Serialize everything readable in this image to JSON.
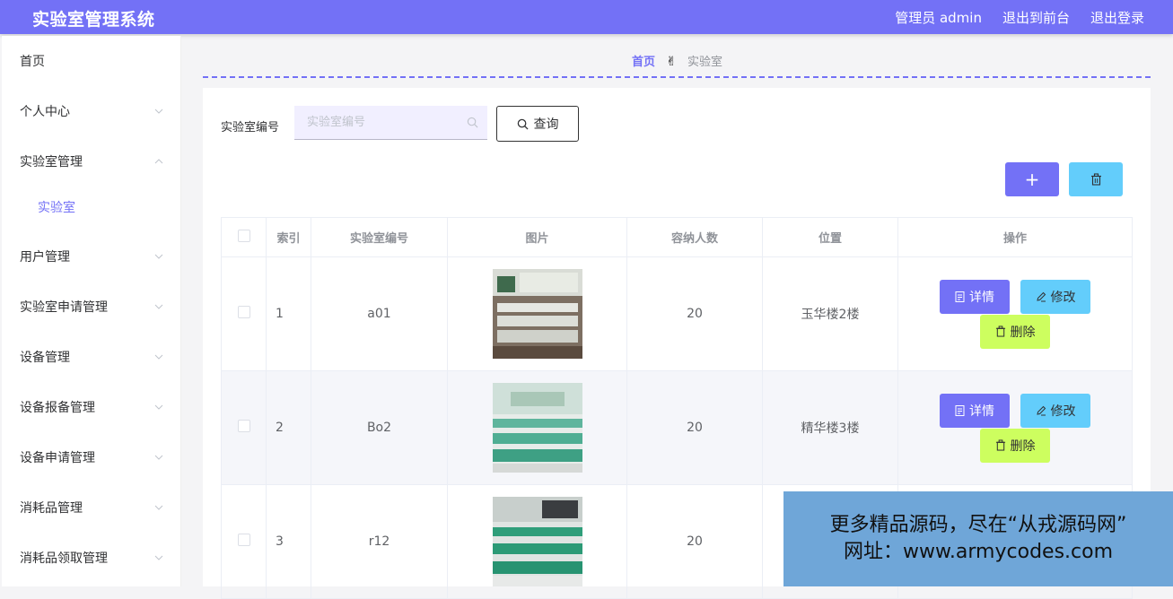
{
  "header": {
    "title": "实验室管理系统",
    "admin_label": "管理员 admin",
    "front_link": "退出到前台",
    "logout_link": "退出登录"
  },
  "sidebar": {
    "items": [
      {
        "label": "首页",
        "icon": "none"
      },
      {
        "label": "个人中心",
        "icon": "chevron-down-icon"
      },
      {
        "label": "实验室管理",
        "icon": "chevron-up-icon"
      },
      {
        "label": "实验室",
        "icon": "none"
      },
      {
        "label": "用户管理",
        "icon": "chevron-down-icon"
      },
      {
        "label": "实验室申请管理",
        "icon": "chevron-down-icon"
      },
      {
        "label": "设备管理",
        "icon": "chevron-down-icon"
      },
      {
        "label": "设备报备管理",
        "icon": "chevron-down-icon"
      },
      {
        "label": "设备申请管理",
        "icon": "chevron-down-icon"
      },
      {
        "label": "消耗品管理",
        "icon": "chevron-down-icon"
      },
      {
        "label": "消耗品领取管理",
        "icon": "chevron-down-icon"
      }
    ]
  },
  "breadcrumb": {
    "home": "首页",
    "separator": "✌",
    "current": "实验室"
  },
  "search": {
    "label": "实验室编号",
    "placeholder": "实验室编号",
    "value": "",
    "button": "查询"
  },
  "toolbar": {
    "add": "+",
    "delete_icon": "trash-icon"
  },
  "table": {
    "headers": [
      "",
      "索引",
      "实验室编号",
      "图片",
      "容纳人数",
      "位置",
      "操作"
    ],
    "rows": [
      {
        "index": "1",
        "code": "a01",
        "capacity": "20",
        "location": "玉华楼2楼",
        "image": "lab-photo-1"
      },
      {
        "index": "2",
        "code": "Bo2",
        "capacity": "20",
        "location": "精华楼3楼",
        "image": "lab-photo-2"
      },
      {
        "index": "3",
        "code": "r12",
        "capacity": "20",
        "location": "",
        "image": "lab-photo-3"
      }
    ],
    "actions": {
      "detail": "详情",
      "edit": "修改",
      "delete": "删除"
    }
  },
  "watermark": {
    "line1": "更多精品源码，尽在“从戎源码网”",
    "line2": "网址：www.armycodes.com"
  },
  "colors": {
    "primary": "#7371f6",
    "info": "#63cdfb",
    "danger": "#cdfe5f",
    "watermark_bg": "#6fa6d8"
  }
}
